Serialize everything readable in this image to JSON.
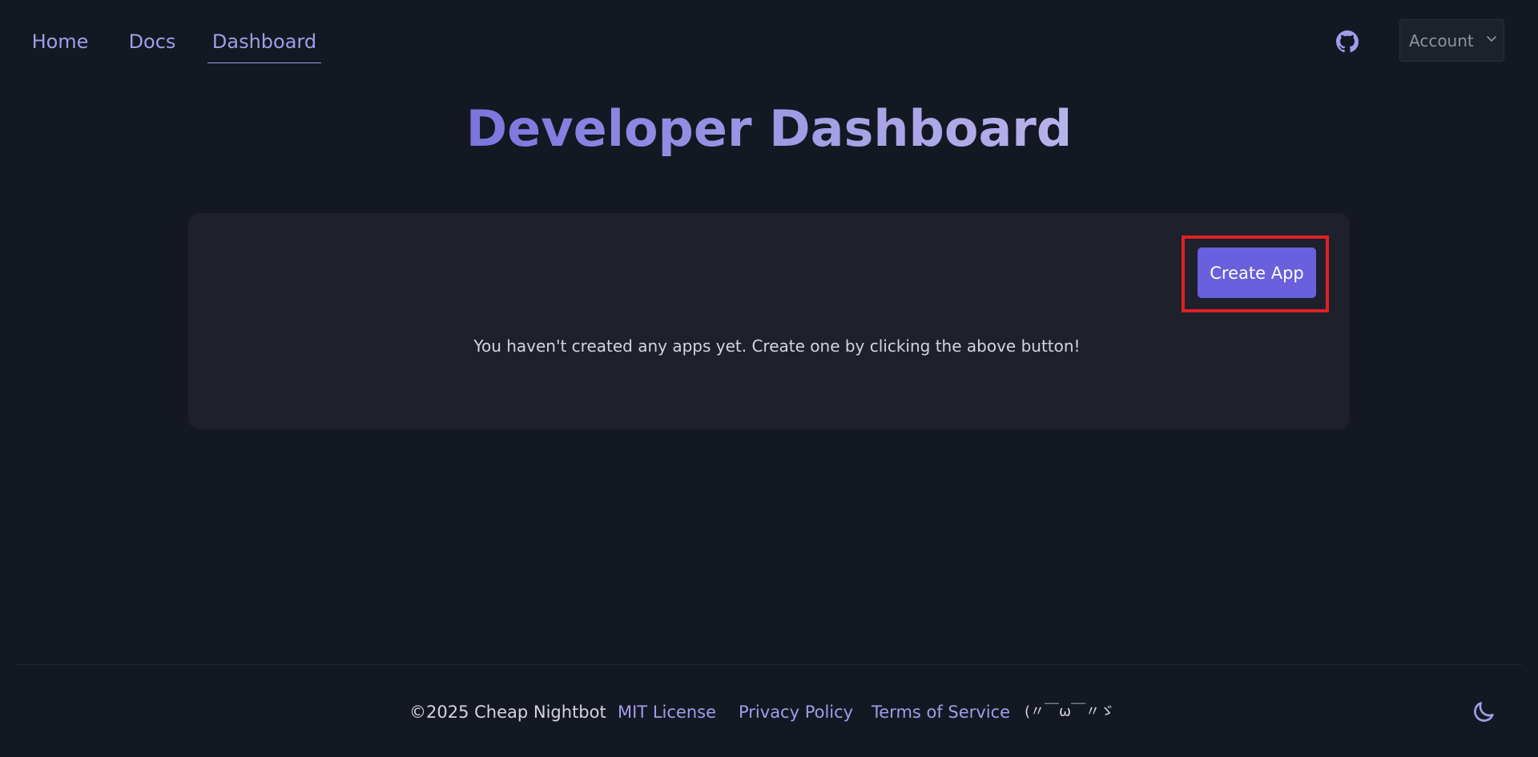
{
  "nav": {
    "home": "Home",
    "docs": "Docs",
    "dashboard": "Dashboard",
    "github_icon": "github-icon",
    "account_label": "Account"
  },
  "main": {
    "title": "Developer Dashboard",
    "create_button": "Create App",
    "empty_message": "You haven't created any apps yet. Create one by clicking the above button!"
  },
  "footer": {
    "copyright": "©2025 Cheap Nightbot",
    "mit_license": "MIT License",
    "privacy_policy": "Privacy Policy",
    "terms_of_service": "Terms of Service",
    "kaomoji": "(〃￣ω￣〃ゞ",
    "theme_icon": "moon-icon"
  },
  "colors": {
    "background": "#141822",
    "card": "#1e212c",
    "accent": "#a39ce8",
    "button": "#6a5fdc",
    "highlight": "#e12026"
  }
}
